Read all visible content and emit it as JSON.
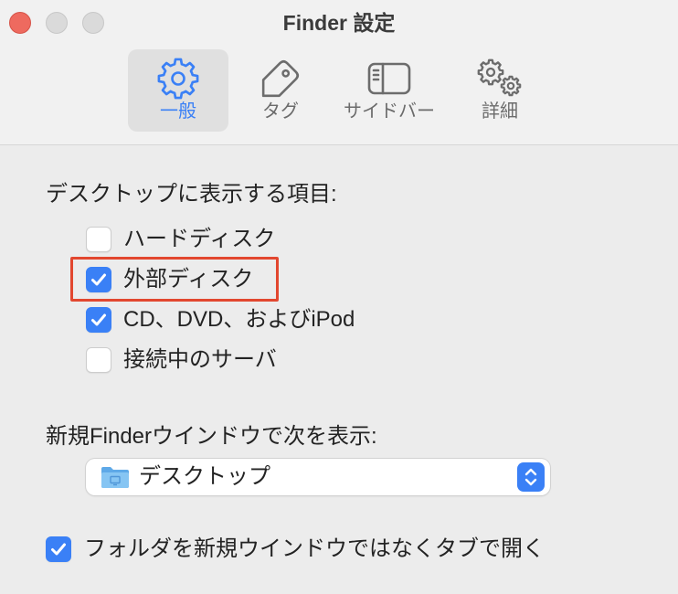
{
  "window": {
    "title": "Finder 設定"
  },
  "colors": {
    "accent": "#3a80f6",
    "close_button": "#ee6a5f",
    "annotation_highlight": "#e2472f"
  },
  "toolbar": {
    "tabs": [
      {
        "label": "一般",
        "icon": "gear-icon",
        "selected": true
      },
      {
        "label": "タグ",
        "icon": "tag-icon",
        "selected": false
      },
      {
        "label": "サイドバー",
        "icon": "sidebar-icon",
        "selected": false
      },
      {
        "label": "詳細",
        "icon": "gears-icon",
        "selected": false
      }
    ]
  },
  "desktop_items": {
    "heading": "デスクトップに表示する項目:",
    "items": [
      {
        "label": "ハードディスク",
        "checked": false,
        "highlighted": false
      },
      {
        "label": "外部ディスク",
        "checked": true,
        "highlighted": true
      },
      {
        "label": "CD、DVD、およびiPod",
        "checked": true,
        "highlighted": false
      },
      {
        "label": "接続中のサーバ",
        "checked": false,
        "highlighted": false
      }
    ]
  },
  "new_window": {
    "heading": "新規Finderウインドウで次を表示:",
    "popup": {
      "selected": "デスクトップ",
      "icon": "folder-icon"
    }
  },
  "open_in_tabs": {
    "label": "フォルダを新規ウインドウではなくタブで開く",
    "checked": true
  }
}
